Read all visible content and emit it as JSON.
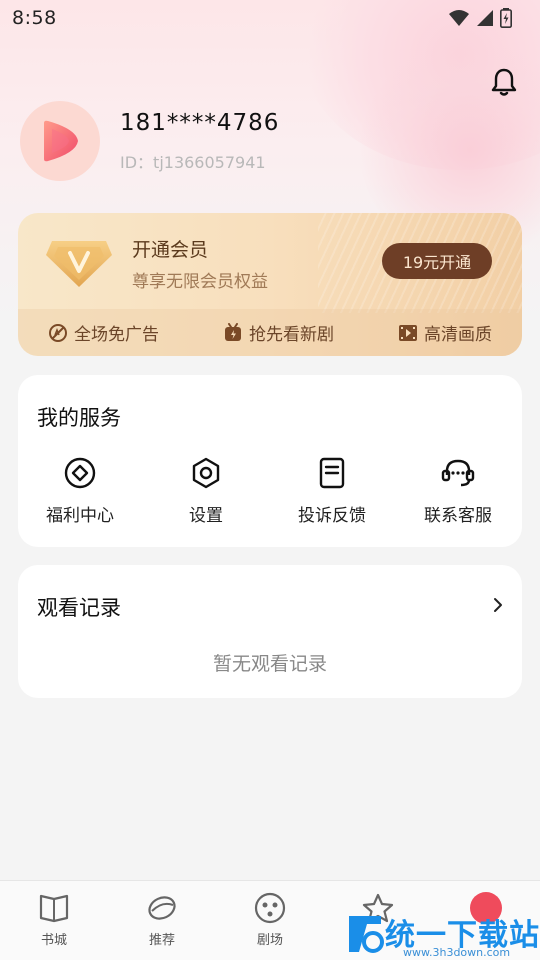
{
  "status_bar": {
    "time": "8:58"
  },
  "profile": {
    "phone": "181****4786",
    "user_id": "ID：tj1366057941"
  },
  "vip": {
    "title": "开通会员",
    "subtitle": "尊享无限会员权益",
    "button": "19元开通",
    "perks": [
      {
        "label": "全场免广告",
        "icon": "no-ads-icon"
      },
      {
        "label": "抢先看新剧",
        "icon": "new-drama-icon"
      },
      {
        "label": "高清画质",
        "icon": "hd-video-icon"
      }
    ]
  },
  "services": {
    "title": "我的服务",
    "items": [
      {
        "label": "福利中心",
        "icon": "welfare-icon"
      },
      {
        "label": "设置",
        "icon": "settings-icon"
      },
      {
        "label": "投诉反馈",
        "icon": "feedback-icon"
      },
      {
        "label": "联系客服",
        "icon": "headset-icon"
      }
    ]
  },
  "history": {
    "title": "观看记录",
    "empty_text": "暂无观看记录"
  },
  "bottom_nav": {
    "items": [
      {
        "label": "书城",
        "icon": "book-icon"
      },
      {
        "label": "推荐",
        "icon": "recommend-icon"
      },
      {
        "label": "剧场",
        "icon": "theater-icon"
      },
      {
        "label": "",
        "icon": "star-icon"
      }
    ]
  },
  "watermark": {
    "text": "统一下载站",
    "url": "www.3h3down.com"
  },
  "colors": {
    "accent": "#ef4b5c",
    "vip_button": "#6e3e26",
    "vip_text": "#5b3a1d"
  }
}
